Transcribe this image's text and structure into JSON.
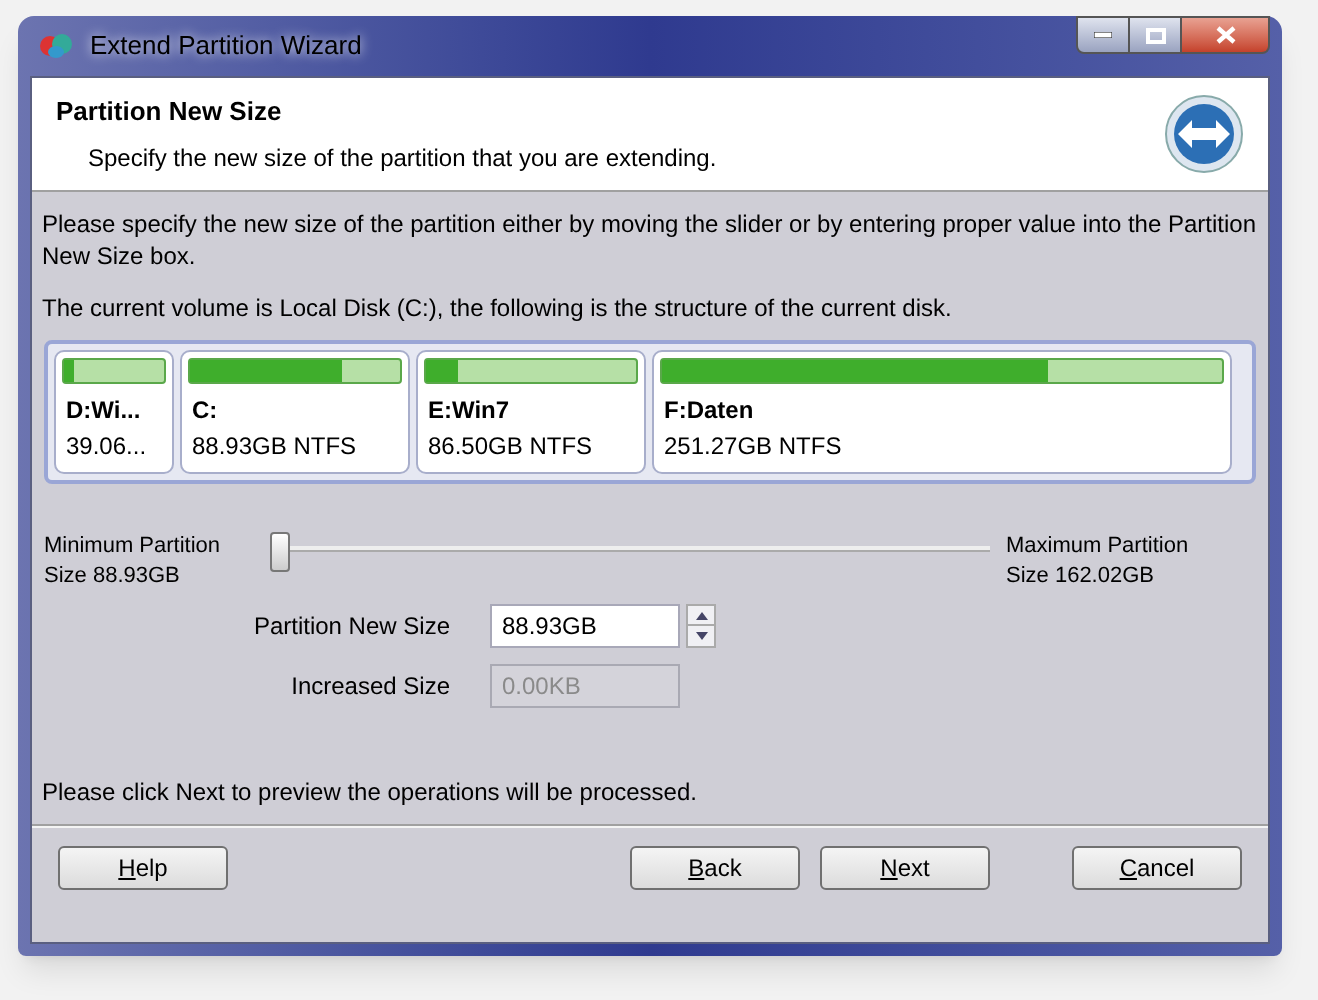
{
  "window": {
    "title": "Extend Partition Wizard"
  },
  "header": {
    "title": "Partition New Size",
    "subtitle": "Specify the new size of the partition that you are extending."
  },
  "instructions": "Please specify the new size of the partition either by moving the slider or by entering proper value into the Partition New Size box.",
  "disk_caption": "The current volume is Local Disk (C:), the following is the structure of the current disk.",
  "partitions": [
    {
      "name": "D:Wi...",
      "size": "39.06...",
      "level": 0.1
    },
    {
      "name": "C:",
      "size": "88.93GB NTFS",
      "level": 0.72
    },
    {
      "name": "E:Win7",
      "size": "86.50GB NTFS",
      "level": 0.15
    },
    {
      "name": "F:Daten",
      "size": "251.27GB NTFS",
      "level": 0.69
    }
  ],
  "slider": {
    "min_label": "Minimum Partition Size 88.93GB",
    "max_label": "Maximum Partition Size 162.02GB",
    "level": 0
  },
  "fields": [
    {
      "label": "Partition New Size",
      "value": "88.93GB",
      "disabled": false,
      "kind": "spin"
    },
    {
      "label": "Increased Size",
      "value": "0.00KB",
      "disabled": true,
      "kind": "text"
    }
  ],
  "footer_note": "Please click Next to preview the operations will be processed.",
  "buttons": [
    {
      "mnemonic": "H",
      "rest": "elp"
    },
    {
      "mnemonic": "B",
      "rest": "ack"
    },
    {
      "mnemonic": "N",
      "rest": "ext"
    },
    {
      "mnemonic": "C",
      "rest": "ancel"
    }
  ]
}
